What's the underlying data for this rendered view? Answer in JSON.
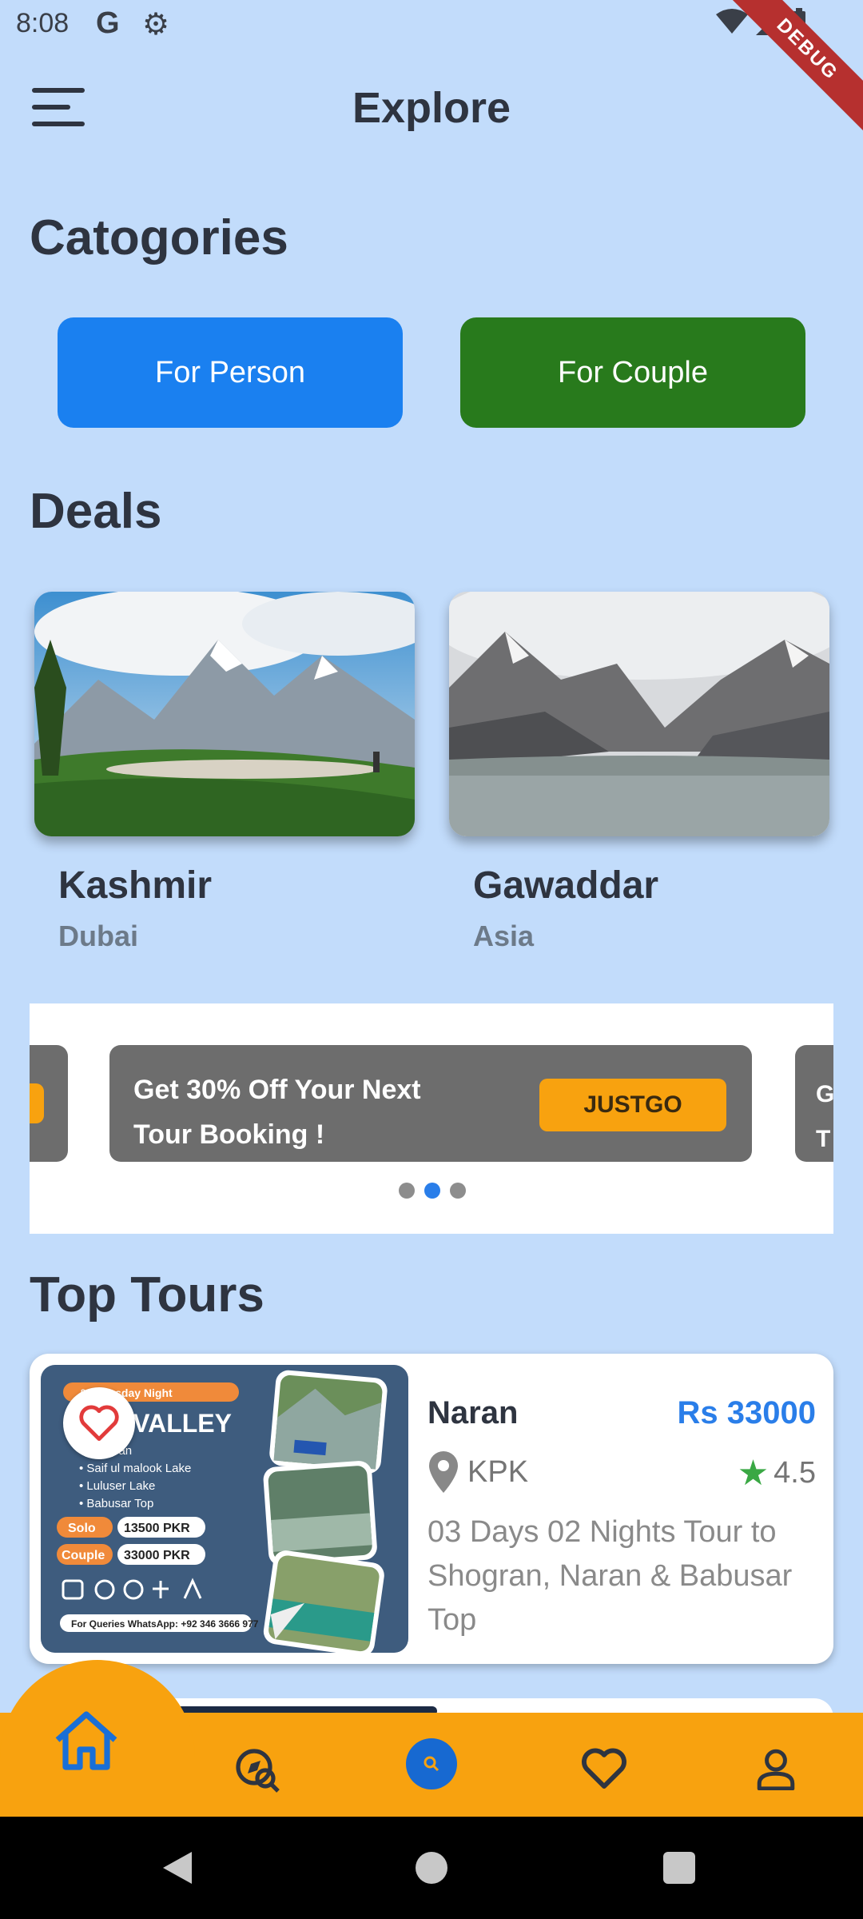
{
  "status_bar": {
    "time": "8:08",
    "g_label": "G",
    "debug_label": "DEBUG"
  },
  "app_bar": {
    "title": "Explore"
  },
  "categories": {
    "title": "Catogories",
    "buttons": [
      {
        "label": "For Person",
        "color": "#1a80f0"
      },
      {
        "label": "For Couple",
        "color": "#287a1c"
      }
    ]
  },
  "deals": {
    "title": "Deals",
    "items": [
      {
        "title": "Kashmir",
        "subtitle": "Dubai"
      },
      {
        "title": "Gawaddar",
        "subtitle": "Asia"
      }
    ]
  },
  "banner": {
    "line1": "Get 30% Off Your Next",
    "line2": "Tour Booking !",
    "button": "JUSTGO",
    "peek_right": "G\nT",
    "active_dot": 1
  },
  "top_tours": {
    "title": "Top Tours",
    "items": [
      {
        "name": "Naran",
        "price": "Rs 33000",
        "location": "KPK",
        "rating": "4.5",
        "description": "03 Days 02 Nights Tour to Shogran, Naran & Babusar Top"
      }
    ]
  },
  "bottom_nav": {
    "items": [
      "home-icon",
      "explore-icon",
      "search-icon",
      "favorite-icon",
      "profile-icon"
    ],
    "active": "home-icon",
    "color": "#f8a20f"
  }
}
